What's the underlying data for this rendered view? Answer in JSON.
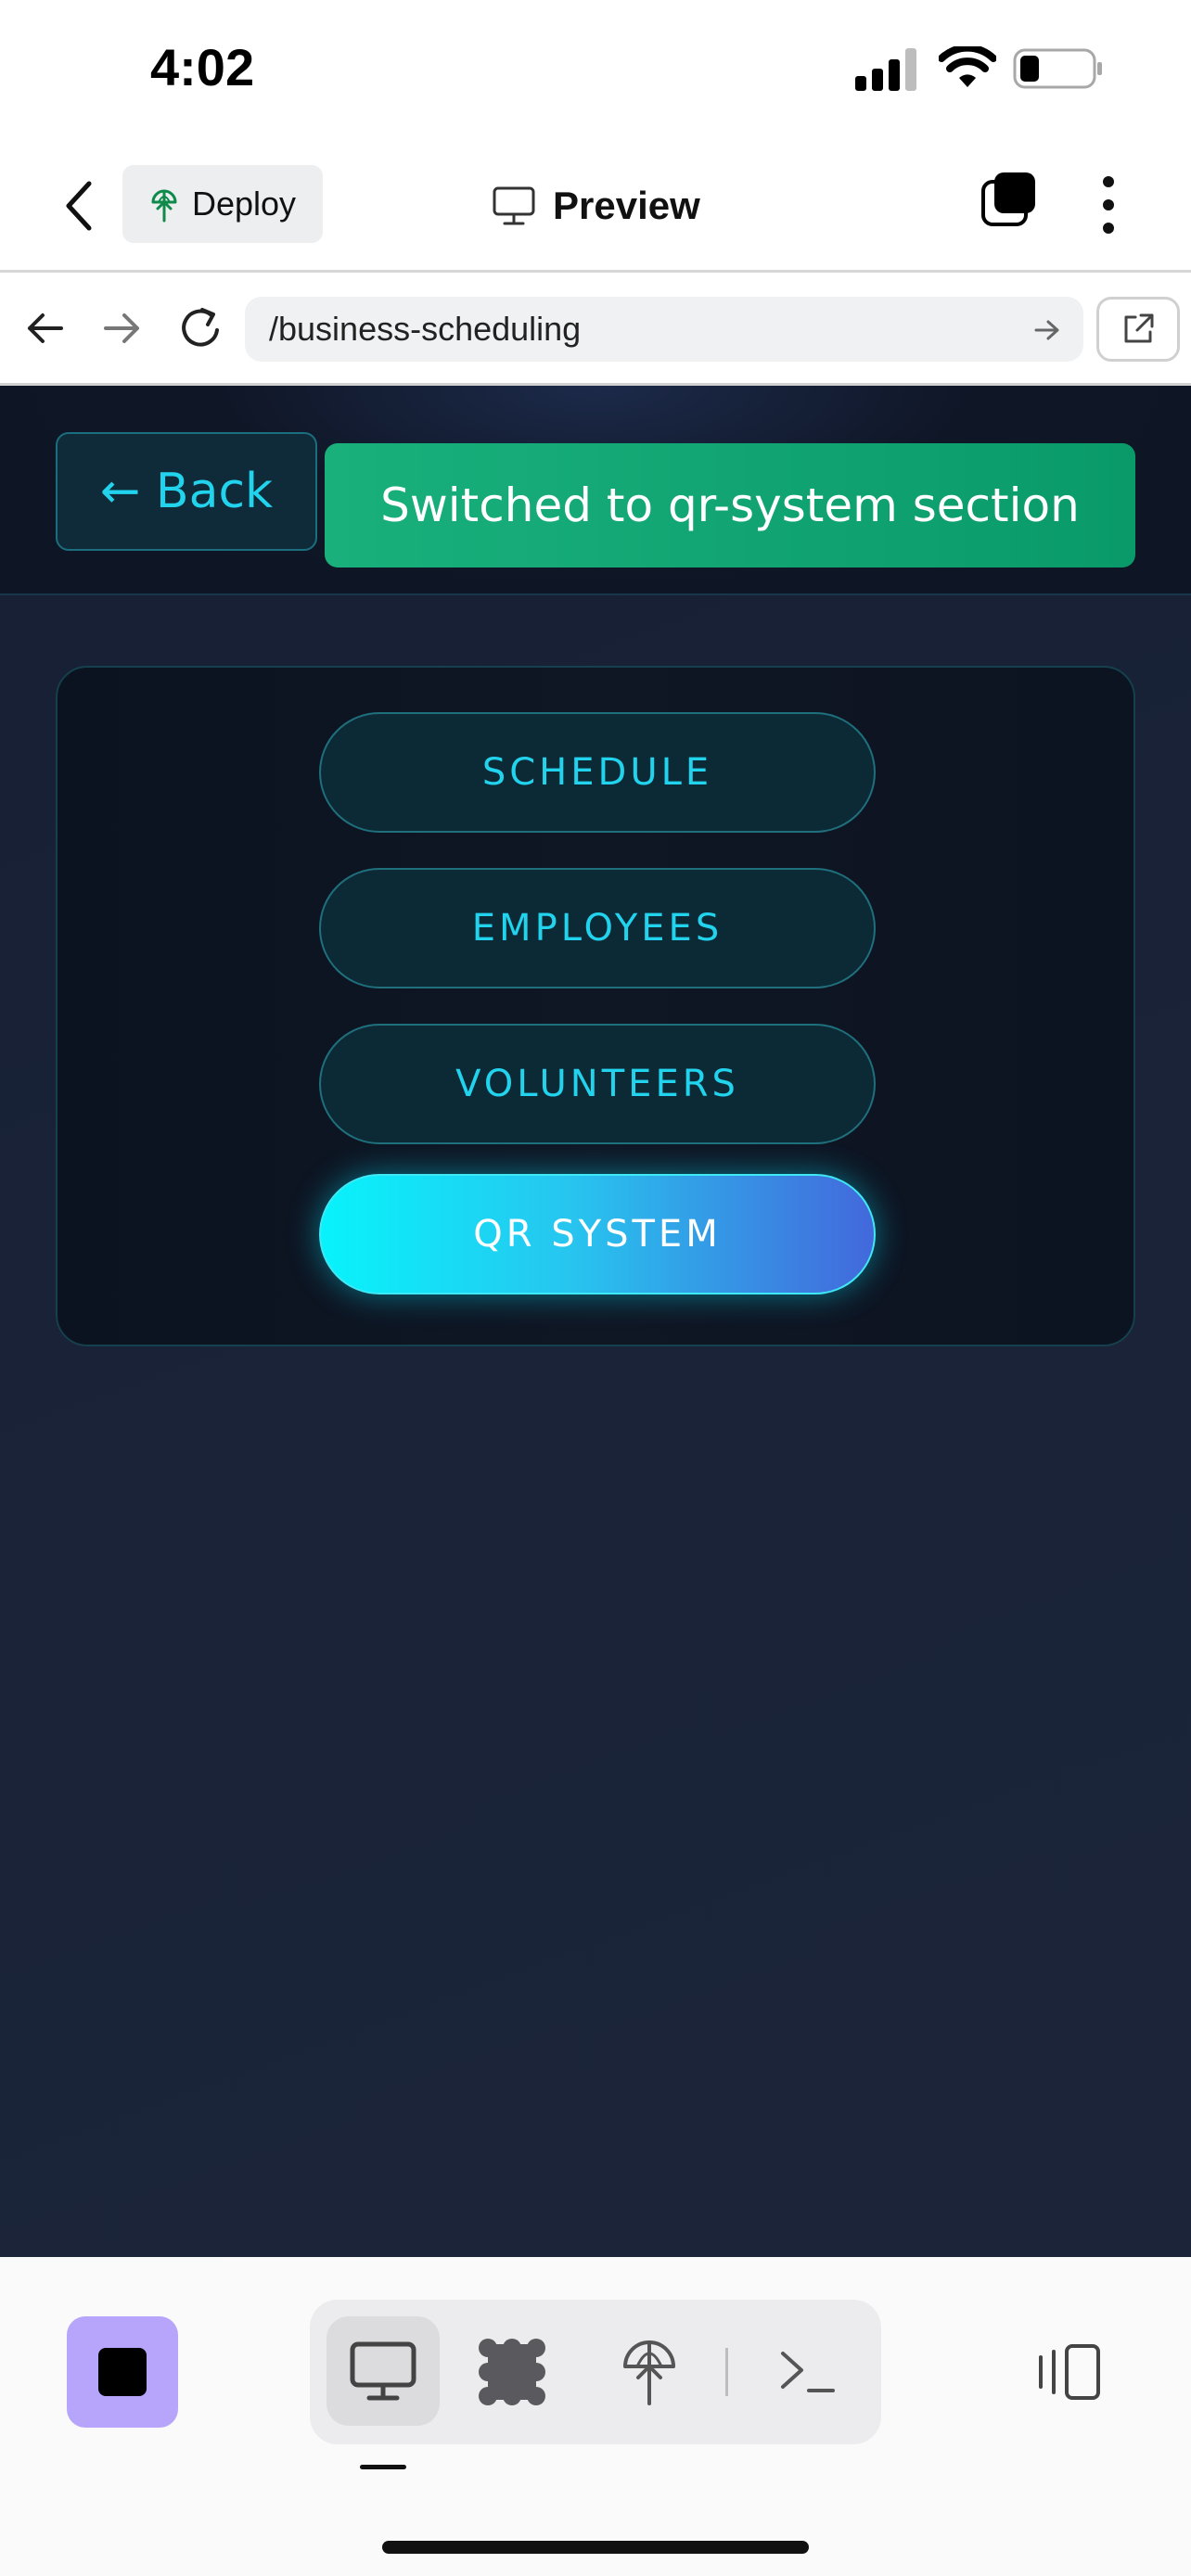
{
  "status_bar": {
    "time": "4:02"
  },
  "app_bar": {
    "deploy_label": "Deploy",
    "preview_label": "Preview"
  },
  "url_bar": {
    "url": "/business-scheduling"
  },
  "page": {
    "back_label": "← Back",
    "toast_message": "Switched to qr-system section",
    "nav_items": [
      {
        "label": "SCHEDULE",
        "active": false
      },
      {
        "label": "EMPLOYEES",
        "active": false
      },
      {
        "label": "VOLUNTEERS",
        "active": false
      },
      {
        "label": "QR SYSTEM",
        "active": true
      }
    ]
  },
  "colors": {
    "accent_cyan": "#22d3ee",
    "toast_green": "#0fa573",
    "stop_button_purple": "#b7a4fb",
    "page_background": "#1a2338"
  },
  "icons": {
    "status": [
      "signal-icon",
      "wifi-icon",
      "battery-icon"
    ],
    "app_bar": [
      "chevron-left-icon",
      "deploy-icon",
      "monitor-icon",
      "tabs-icon",
      "more-vertical-icon"
    ],
    "url_bar": [
      "arrow-left-icon",
      "arrow-right-icon",
      "reload-icon",
      "arrow-right-small-icon",
      "external-link-icon"
    ],
    "bottom_bar": [
      "stop-icon",
      "monitor-icon",
      "grid-icon",
      "deploy-icon",
      "terminal-icon",
      "panel-icon"
    ]
  }
}
